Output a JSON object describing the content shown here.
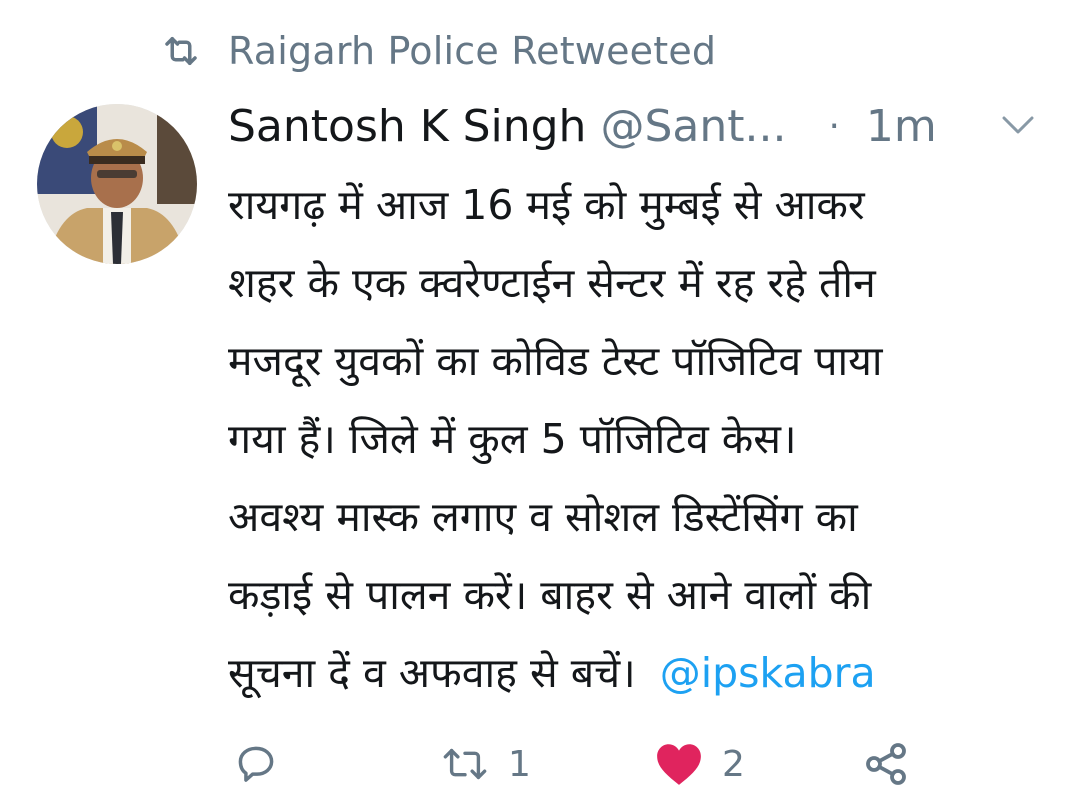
{
  "retweet_header": {
    "icon": "retweet-icon",
    "text": "Raigarh Police Retweeted"
  },
  "tweet": {
    "author": {
      "display_name": "Santosh K Singh",
      "handle": "@Sant...",
      "avatar": "avatar-police-officer"
    },
    "separator": "·",
    "time": "1m",
    "menu_icon": "chevron-down-icon",
    "text_lines": [
      "रायगढ़ में आज 16 मई को मुम्बई से आकर",
      "शहर के एक क्वरेण्टाईन सेन्टर में रह रहे तीन",
      "मजदूर युवकों का कोविड टेस्ट पॉजिटिव पाया",
      "गया हैं। जिले में कुल 5 पॉजिटिव केस।",
      "अवश्य मास्क लगाए व सोशल डिस्टेंसिंग का",
      "कड़ाई से पालन करें। बाहर से आने वालों की",
      "सूचना दें व अफवाह से बचें।"
    ],
    "mention": "@ipskabra",
    "actions": {
      "reply": {
        "icon": "reply-icon"
      },
      "retweet": {
        "icon": "retweet-icon",
        "count": "1"
      },
      "like": {
        "icon": "heart-icon",
        "count": "2",
        "color": "#e0245e"
      },
      "share": {
        "icon": "share-icon"
      }
    }
  },
  "colors": {
    "text": "#14171a",
    "secondary": "#657786",
    "link": "#1da1f2",
    "like": "#e0245e"
  }
}
